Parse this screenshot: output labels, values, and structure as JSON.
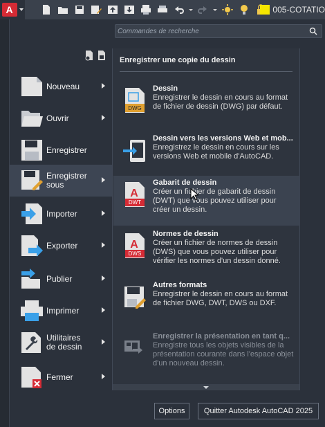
{
  "app": {
    "logo_letter": "A",
    "document_title": "005-COTATIO"
  },
  "search": {
    "placeholder": "Commandes de recherche"
  },
  "left_menu": {
    "items": [
      {
        "label": "Nouveau",
        "icon": "new-document-icon",
        "has_submenu": true
      },
      {
        "label": "Ouvrir",
        "icon": "open-folder-icon",
        "has_submenu": true
      },
      {
        "label": "Enregistrer",
        "icon": "save-disk-icon",
        "has_submenu": false
      },
      {
        "label": "Enregistrer\nsous",
        "icon": "save-as-icon",
        "has_submenu": true,
        "active": true
      },
      {
        "label": "Importer",
        "icon": "import-icon",
        "has_submenu": true
      },
      {
        "label": "Exporter",
        "icon": "export-icon",
        "has_submenu": true
      },
      {
        "label": "Publier",
        "icon": "publish-icon",
        "has_submenu": true
      },
      {
        "label": "Imprimer",
        "icon": "printer-icon",
        "has_submenu": true
      },
      {
        "label": "Utilitaires\nde dessin",
        "icon": "drawing-utilities-icon",
        "has_submenu": true
      },
      {
        "label": "Fermer",
        "icon": "close-document-icon",
        "has_submenu": true
      }
    ]
  },
  "panel": {
    "title": "Enregistrer une copie du dessin",
    "entries": [
      {
        "name": "Dessin",
        "desc": "Enregistrer le dessin en cours au format de fichier de dessin (DWG) par défaut.",
        "icon": "dwg-file-icon",
        "badge": "DWG"
      },
      {
        "name": "Dessin vers les versions Web et mob...",
        "desc": "Enregistrez le dessin en cours sur les versions Web et mobile d'AutoCAD.",
        "icon": "web-mobile-icon"
      },
      {
        "name": "Gabarit de dessin",
        "desc": "Créer un fichier de gabarit de dessin (DWT) que vous pouvez utiliser pour créer un dessin.",
        "icon": "dwt-file-icon",
        "badge": "DWT",
        "hovered": true
      },
      {
        "name": "Normes de dessin",
        "desc": "Créer un fichier de normes de dessin (DWS) que vous pouvez utiliser pour vérifier les normes d'un dessin donné.",
        "icon": "dws-file-icon",
        "badge": "DWS"
      },
      {
        "name": "Autres formats",
        "desc": "Enregistrer le dessin en cours au format de fichier DWG, DWT, DWS ou DXF.",
        "icon": "other-formats-icon"
      },
      {
        "name": "Enregistrer la présentation en tant q...",
        "desc": "Enregistre tous les objets visibles de la présentation courante dans l'espace objet d'un nouveau dessin.",
        "icon": "layout-save-icon",
        "disabled": true
      }
    ]
  },
  "buttons": {
    "options": "Options",
    "quit": "Quitter Autodesk AutoCAD 2025"
  },
  "colors": {
    "accent_red": "#d52b35",
    "background": "#2b313b",
    "panel": "#2e343e",
    "highlight": "#3b4350"
  }
}
